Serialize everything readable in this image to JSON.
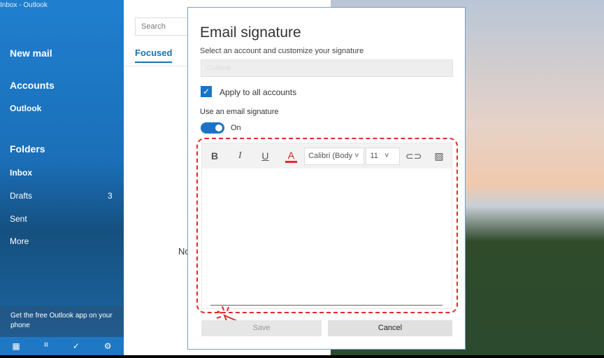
{
  "window": {
    "title": "Inbox - Outlook"
  },
  "sidebar": {
    "new_mail": "New mail",
    "accounts": "Accounts",
    "account": "Outlook",
    "folders": "Folders",
    "items": [
      {
        "label": "Inbox"
      },
      {
        "label": "Drafts",
        "count": "3"
      },
      {
        "label": "Sent"
      },
      {
        "label": "More"
      }
    ],
    "promo": "Get the free Outlook app on your phone"
  },
  "list": {
    "search_placeholder": "Search",
    "tab_focused": "Focused",
    "empty_text": "Nothing"
  },
  "dialog": {
    "title": "Email signature",
    "subtitle": "Select an account and customize your signature",
    "account_value": "Outlook",
    "apply_all": "Apply to all accounts",
    "apply_all_checked": true,
    "use_signature": "Use an email signature",
    "toggle_state": "On",
    "toolbar": {
      "bold": "B",
      "italic": "I",
      "underline": "U",
      "font_color": "A",
      "font": "Calibri (Body",
      "size": "11"
    },
    "save": "Save",
    "cancel": "Cancel"
  },
  "colors": {
    "accent": "#1a73c8",
    "highlight": "#e02b2b"
  }
}
